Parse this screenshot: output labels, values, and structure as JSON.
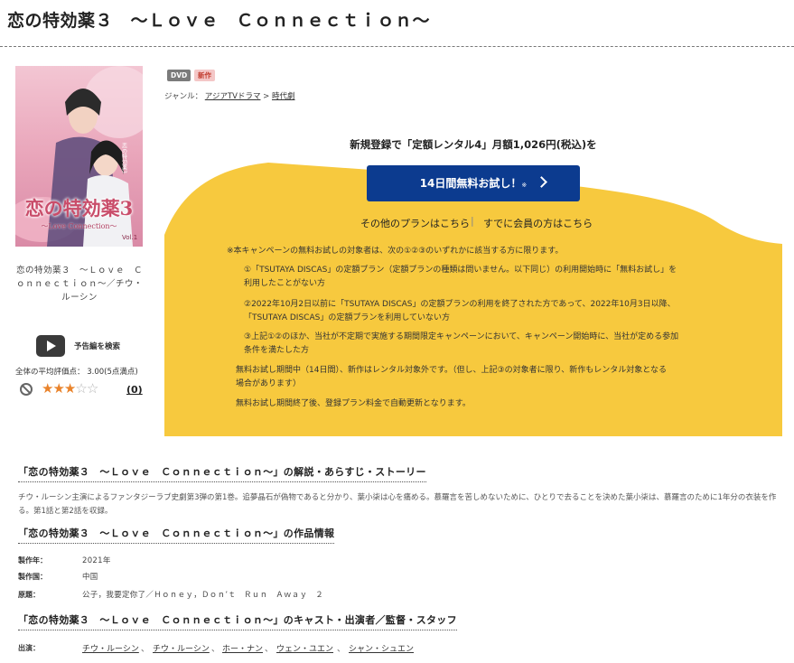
{
  "title": "恋の特効薬３　～Ｌｏｖｅ　Ｃｏｎｎｅｃｔｉｏｎ～",
  "cover": {
    "title_text": "恋の特効薬3",
    "subtitle_text": "～Love Connection～",
    "vol_text": "Vol.1",
    "caption": "恋の特効薬３　～Ｌｏｖｅ　Ｃｏｎｎｅｃｔｉｏｎ～／チウ・ルーシン"
  },
  "trailer_label": "予告編を検索",
  "rating": {
    "text": "全体の平均評価点： 3.00(5点満点)",
    "value": 3,
    "max": 5,
    "count": "(0)"
  },
  "badges": {
    "format": "DVD",
    "new": "新作"
  },
  "genre": {
    "label": "ジャンル：",
    "primary": "アジアTVドラマ",
    "separator": ">",
    "secondary": "時代劇"
  },
  "promo": {
    "heading": "新規登録で「定額レンタル4」月額1,026円(税込)を",
    "trial_button": "14日間無料お試し！",
    "trial_mark": "※",
    "other_plans": "その他のプランはこちら",
    "separator": "|",
    "member_link": "すでに会員の方はこちら",
    "notes": [
      "※本キャンペーンの無料お試しの対象者は、次の①②③のいずれかに該当する方に限ります。",
      "①「TSUTAYA DISCAS」の定額プラン（定額プランの種類は問いません。以下同じ）の利用開始時に「無料お試し」を",
      "利用したことがない方",
      "②2022年10月2日以前に「TSUTAYA DISCAS」の定額プランの利用を終了された方であって、2022年10月3日以降、",
      "「TSUTAYA DISCAS」の定額プランを利用していない方",
      "③上記①②のほか、当社が不定期で実施する期間限定キャンペーンにおいて、キャンペーン開始時に、当社が定める参加",
      "条件を満たした方",
      "無料お試し期間中（14日間）、新作はレンタル対象外です。（但し、上記③の対象者に限り、新作もレンタル対象となる",
      "場合があります）",
      "無料お試し期間終了後、登録プラン料金で自動更新となります。"
    ]
  },
  "synopsis": {
    "heading": "「恋の特効薬３　～Ｌｏｖｅ　Ｃｏｎｎｅｃｔｉｏｎ～」の解説・あらすじ・ストーリー",
    "text": "チウ・ルーシン主演によるファンタジーラブ史劇第3弾の第1巻。追夢晶石が偽物であると分かり、葉小柒は心を痛める。慕羅言を苦しめないために、ひとりで去ることを決めた葉小柒は、慕羅言のために1年分の衣装を作る。第1話と第2話を収録。"
  },
  "work_info": {
    "heading": "「恋の特効薬３　～Ｌｏｖｅ　Ｃｏｎｎｅｃｔｉｏｎ～」の作品情報",
    "rows": [
      {
        "label": "製作年：",
        "value": "2021年"
      },
      {
        "label": "製作国：",
        "value": "中国"
      },
      {
        "label": "原題：",
        "value": "公子，我要定你了／Ｈｏｎｅｙ，Ｄｏｎ’ｔ　Ｒｕｎ　Ａｗａｙ　２"
      }
    ]
  },
  "cast": {
    "heading": "「恋の特効薬３　～Ｌｏｖｅ　Ｃｏｎｎｅｃｔｉｏｎ～」のキャスト・出演者／監督・スタッフ",
    "label": "出演：",
    "names": [
      "チウ・ルーシン",
      "チウ・ルーシン",
      "ホー・ナン",
      "ウェン・ユエン",
      "シャン・シュエン"
    ],
    "separator": "、"
  },
  "colors": {
    "promo_yellow": "#f7c93e",
    "button_blue": "#0c3b8f",
    "star_on": "#e9832b",
    "star_off": "#b5b5b5"
  }
}
